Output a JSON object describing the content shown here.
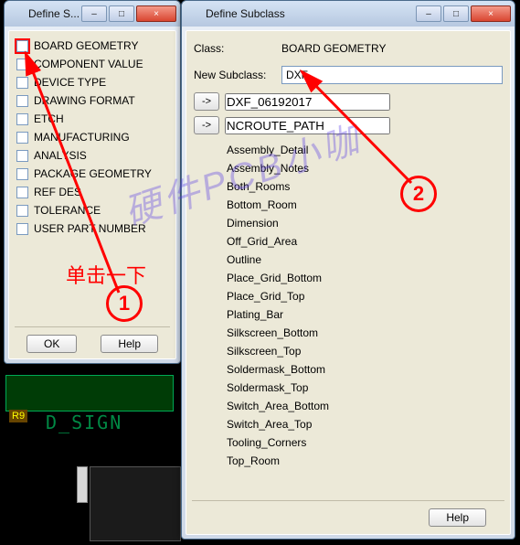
{
  "left_window": {
    "title": "Define S...",
    "controls": {
      "min": "–",
      "max": "□",
      "close": "×"
    },
    "items": [
      "BOARD GEOMETRY",
      "COMPONENT VALUE",
      "DEVICE TYPE",
      "DRAWING FORMAT",
      "ETCH",
      "MANUFACTURING",
      "ANALYSIS",
      "PACKAGE GEOMETRY",
      "REF DES",
      "TOLERANCE",
      "USER PART NUMBER"
    ],
    "buttons": {
      "ok": "OK",
      "help": "Help"
    }
  },
  "right_window": {
    "title": "Define Subclass",
    "controls": {
      "min": "–",
      "max": "□",
      "close": "×"
    },
    "class_label": "Class:",
    "class_value": "BOARD GEOMETRY",
    "new_subclass_label": "New Subclass:",
    "new_subclass_value": "DXF",
    "arrow": "->",
    "nav": [
      "DXF_06192017",
      "NCROUTE_PATH"
    ],
    "subclasses": [
      "Assembly_Detail",
      "Assembly_Notes",
      "Both_Rooms",
      "Bottom_Room",
      "Dimension",
      "Off_Grid_Area",
      "Outline",
      "Place_Grid_Bottom",
      "Place_Grid_Top",
      "Plating_Bar",
      "Silkscreen_Bottom",
      "Silkscreen_Top",
      "Soldermask_Bottom",
      "Soldermask_Top",
      "Switch_Area_Bottom",
      "Switch_Area_Top",
      "Tooling_Corners",
      "Top_Room"
    ],
    "help": "Help"
  },
  "annotations": {
    "click_text": "单击一下",
    "circle1": "1",
    "circle2": "2",
    "watermark": "硬件PCB小咖"
  },
  "pcb": {
    "signal": "D_SIGN",
    "r9": "R9"
  }
}
